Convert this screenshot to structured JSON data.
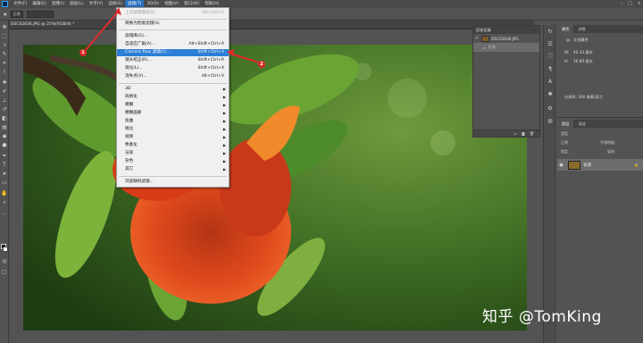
{
  "menubar": {
    "items": [
      "文件(F)",
      "编辑(E)",
      "图像(I)",
      "图层(L)",
      "文字(Y)",
      "选择(S)",
      "滤镜(T)",
      "3D(D)",
      "视图(V)",
      "窗口(W)",
      "帮助(H)"
    ],
    "active_index": 6
  },
  "optbar": {
    "mode": "正常",
    "opacity": "流量"
  },
  "document": {
    "tab_title": "DSC02636.JPG @ 25%(RGB/8) *"
  },
  "filter_menu": {
    "last_filter": {
      "label": "上次滤镜操作(F)",
      "shortcut": "Alt+Ctrl+F"
    },
    "convert_smart": {
      "label": "转换为智能滤镜(S)"
    },
    "filter_gallery": {
      "label": "滤镜库(G)..."
    },
    "adaptive_wide": {
      "label": "自适应广角(A)...",
      "shortcut": "Alt+Shift+Ctrl+A"
    },
    "camera_raw": {
      "label": "Camera Raw 滤镜(C)...",
      "shortcut": "Shift+Ctrl+A"
    },
    "lens_correction": {
      "label": "镜头校正(R)...",
      "shortcut": "Shift+Ctrl+R"
    },
    "liquify": {
      "label": "液化(L)...",
      "shortcut": "Shift+Ctrl+X"
    },
    "vanishing_point": {
      "label": "消失点(V)...",
      "shortcut": "Alt+Ctrl+V"
    },
    "submenus": [
      "3D",
      "风格化",
      "模糊",
      "模糊画廊",
      "扭曲",
      "锐化",
      "视频",
      "像素化",
      "渲染",
      "杂色",
      "其它"
    ],
    "browse_online": {
      "label": "浏览联机滤镜..."
    }
  },
  "history": {
    "title": "历史记录",
    "snapshot": "DSC02636.JPG",
    "open_label": "打开"
  },
  "properties": {
    "tabs": [
      "属性",
      "调整"
    ],
    "title": "文档属性",
    "w_label": "W:",
    "w_value": "40.34 厘米",
    "h_label": "H:",
    "h_value": "26.89 厘米",
    "resolution": "分辨率: 300 像素/英寸"
  },
  "layers": {
    "tabs": [
      "图层",
      "通道"
    ],
    "kind": "类型",
    "blend": "正常",
    "opacity_label": "不透明度:",
    "lock_label": "锁定:",
    "fill_label": "填充:",
    "layer_name": "背景"
  },
  "annotations": {
    "badge1": "1",
    "badge2": "2"
  },
  "watermark": "知乎 @TomKing",
  "colors": {
    "highlight": "#2d7fd6",
    "badge": "#e02b2b",
    "panel": "#535353"
  }
}
